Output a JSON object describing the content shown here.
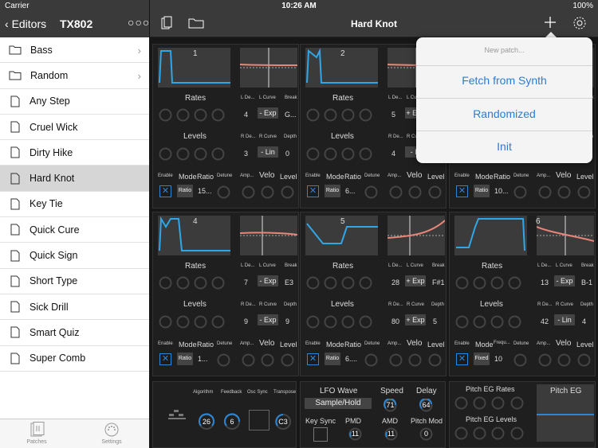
{
  "status": {
    "carrier": "Carrier",
    "time": "10:26 AM",
    "battery": "100%"
  },
  "sidebar": {
    "back": "Editors",
    "title": "TX802",
    "more": "○○○",
    "items": [
      {
        "label": "Bass",
        "type": "folder"
      },
      {
        "label": "Random",
        "type": "folder"
      },
      {
        "label": "Any Step",
        "type": "file"
      },
      {
        "label": "Cruel Wick",
        "type": "file"
      },
      {
        "label": "Dirty Hike",
        "type": "file"
      },
      {
        "label": "Hard Knot",
        "type": "file",
        "selected": true
      },
      {
        "label": "Key Tie",
        "type": "file"
      },
      {
        "label": "Quick Cure",
        "type": "file"
      },
      {
        "label": "Quick Sign",
        "type": "file"
      },
      {
        "label": "Short Type",
        "type": "file"
      },
      {
        "label": "Sick Drill",
        "type": "file"
      },
      {
        "label": "Smart Quiz",
        "type": "file"
      },
      {
        "label": "Super Comb",
        "type": "file"
      }
    ],
    "tabs": {
      "patches": "Patches",
      "settings": "Settings"
    }
  },
  "main": {
    "title": "Hard Knot"
  },
  "menu": {
    "header": "New patch...",
    "fetch": "Fetch from Synth",
    "randomized": "Randomized",
    "init": "Init"
  },
  "labels": {
    "rates": "Rates",
    "levels": "Levels",
    "l_de": "L De...",
    "l_curve": "L Curve",
    "break": "Break",
    "r_de": "R De...",
    "r_curve": "R Curve",
    "depth": "Depth",
    "enable": "Enable",
    "mode": "Mode",
    "ratio": "Ratio",
    "detune": "Detune",
    "amp": "Amp...",
    "velo": "Velo",
    "level": "Level",
    "frequ": "Frequ..."
  },
  "ops": [
    {
      "num": "1",
      "rates": [
        "82",
        "70",
        "70",
        "82"
      ],
      "l_de": "4",
      "l_curve": "- Exp",
      "break": "G...",
      "levels": [
        "99",
        "84",
        "86",
        "0"
      ],
      "r_de": "3",
      "r_curve": "- Lin",
      "depth": "0",
      "enable": "✕",
      "mode": "Ratio",
      "ratio": "15...",
      "detune": "-2",
      "amp": "1",
      "velo": "6",
      "level": "92"
    },
    {
      "num": "2",
      "rates": [
        "88",
        "97",
        "42",
        "30"
      ],
      "l_de": "5",
      "l_curve": "+ Exp",
      "break": "",
      "levels": [
        "98",
        "73",
        "82",
        "0"
      ],
      "r_de": "4",
      "r_curve": "- Li",
      "depth": "",
      "enable": "✕",
      "mode": "Ratio",
      "ratio": "6...",
      "detune": "-4",
      "amp": "2",
      "velo": "5",
      "level": "98"
    },
    {
      "num": "3",
      "rates": [
        "",
        "",
        "",
        ""
      ],
      "l_de": "",
      "l_curve": "",
      "break": "",
      "levels": [
        "",
        "",
        "",
        ""
      ],
      "r_de": "",
      "r_curve": "",
      "depth": "",
      "enable": "✕",
      "mode": "Ratio",
      "ratio": "10...",
      "detune": "-3",
      "amp": "2",
      "velo": "5",
      "level": "22"
    },
    {
      "num": "4",
      "rates": [
        "83",
        "42",
        "78",
        "51"
      ],
      "l_de": "7",
      "l_curve": "- Exp",
      "break": "E3",
      "levels": [
        "99",
        "73",
        "96",
        "0"
      ],
      "r_de": "9",
      "r_curve": "- Exp",
      "depth": "9",
      "enable": "✕",
      "mode": "Ratio",
      "ratio": "1...",
      "detune": "4",
      "amp": "0",
      "velo": "1",
      "level": "93"
    },
    {
      "num": "5",
      "rates": [
        "9",
        "98",
        "51",
        "24"
      ],
      "l_de": "28",
      "l_curve": "+ Exp",
      "break": "F#1",
      "levels": [
        "34",
        "34",
        "16",
        "60"
      ],
      "r_de": "80",
      "r_curve": "+ Exp",
      "depth": "5",
      "enable": "✕",
      "mode": "Ratio",
      "ratio": "6....",
      "detune": "-6",
      "amp": "1",
      "velo": "5",
      "level": "3"
    },
    {
      "num": "6",
      "rates": [
        "3",
        "88",
        "84",
        "36"
      ],
      "l_de": "13",
      "l_curve": "- Exp",
      "break": "B-1",
      "levels": [
        "5",
        "45",
        "58",
        "98"
      ],
      "r_de": "42",
      "r_curve": "- Lin",
      "depth": "4",
      "enable": "✕",
      "mode": "Fixed",
      "ratio": "10",
      "detune": "0",
      "amp": "0",
      "velo": "0",
      "level": "98"
    }
  ],
  "bottom": {
    "algorithm_label": "Algorithm",
    "feedback_label": "Feedback",
    "oscsync_label": "Osc Sync",
    "transpose_label": "Transpose",
    "algorithm": "26",
    "feedback": "6",
    "transpose": "C3",
    "lfo_wave_label": "LFO Wave",
    "lfo_wave": "Sample/Hold",
    "speed_label": "Speed",
    "speed": "71",
    "delay_label": "Delay",
    "delay": "64",
    "keysync_label": "Key Sync",
    "pmd_label": "PMD",
    "pmd": "11",
    "amd_label": "AMD",
    "amd": "11",
    "pitchmod_label": "Pitch Mod",
    "pitchmod": "0",
    "peg_rates_label": "Pitch EG Rates",
    "peg_rates": [
      "8",
      "25",
      "34",
      "51"
    ],
    "peg_levels_label": "Pitch EG Levels",
    "peg_levels": [
      "50",
      "50",
      "50",
      "50"
    ],
    "peg_label": "Pitch EG"
  },
  "colors": {
    "accent": "#2a87d8",
    "curve": "#e8867a",
    "panel": "#3b3b3b"
  }
}
